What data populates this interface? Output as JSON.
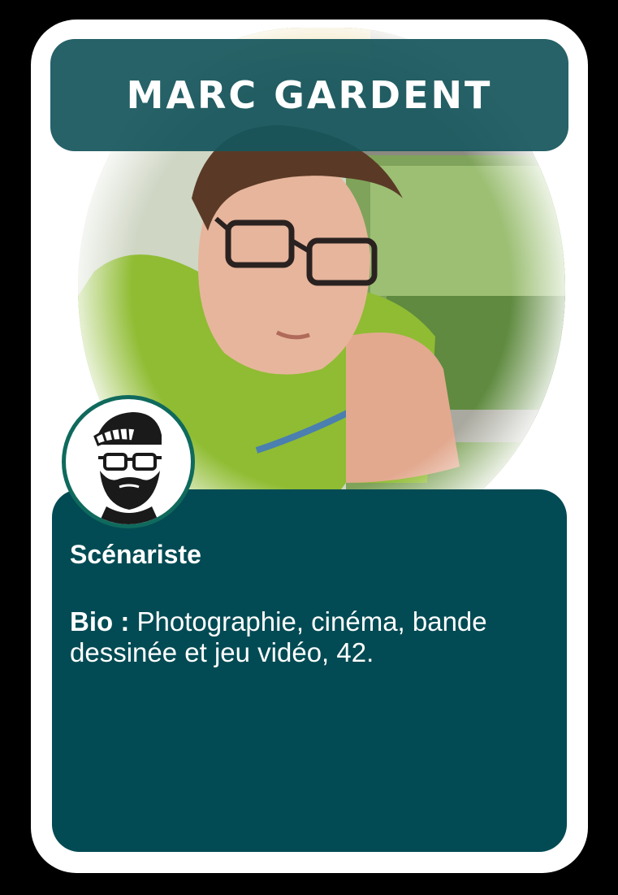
{
  "card": {
    "name": "MARC GARDENT",
    "role": "Scénariste",
    "bio_label": "Bio :",
    "bio_text": "Photographie, cinéma, bande dessinée et jeu vidéo, 42."
  },
  "colors": {
    "banner": "#16565c",
    "panel": "#024b54",
    "avatar_ring": "#0f6a5d",
    "card": "#ffffff"
  },
  "icons": {
    "avatar": "bearded-man-cap-glasses-icon"
  }
}
